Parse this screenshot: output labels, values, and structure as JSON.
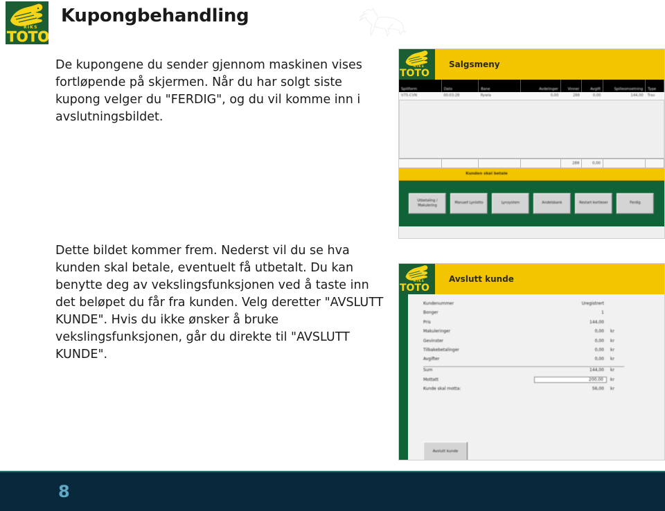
{
  "header": {
    "title": "Kupongbehandling",
    "logo": {
      "riks": "RIKS",
      "toto": "TOTO"
    }
  },
  "content": {
    "paragraph_1": "De kupongene du sender gjennom maskinen vises fortløpende på skjermen. Når du har solgt siste kupong velger du \"FERDIG\", og du vil komme inn i avslutningsbildet.",
    "paragraph_2": "Dette bildet kommer frem. Nederst vil du se hva kunden skal betale, eventuelt få utbetalt. Du kan benytte deg av vekslingsfunksjonen ved å taste inn det beløpet du får fra kunden. Velg deretter \"AVSLUTT KUNDE\". Hvis du ikke ønsker å bruke vekslingsfunksjonen, går du direkte til \"AVSLUTT KUNDE\"."
  },
  "screenshot_salgsmeny": {
    "title": "Salgsmeny",
    "logo": {
      "riks": "RIKS",
      "toto": "TOTO"
    },
    "table": {
      "columns": [
        "Spillform",
        "Dato",
        "Bane",
        "Avdelinger",
        "Vinner",
        "Avgift",
        "Spilleomsetning",
        "Type"
      ],
      "rows": [
        [
          "V75-CVN",
          "00:03:28",
          "Rywla",
          "0,00",
          "288",
          "0,00",
          "144,00",
          "Trav"
        ]
      ],
      "totals": [
        "",
        "",
        "",
        "",
        "288",
        "0,00",
        "",
        ""
      ]
    },
    "pay_bar_label": "Kunden skal betale",
    "buttons": [
      "Utbetaling / Makulering",
      "Manuell Lynlotto",
      "Lynsystem",
      "Andelsbank",
      "Restart kortleser",
      "Ferdig"
    ]
  },
  "screenshot_avslutt": {
    "title": "Avslutt kunde",
    "logo": {
      "riks": "RIKS",
      "toto": "TOTO"
    },
    "rows": [
      {
        "label": "Kundenummer",
        "value": "Uregistrert",
        "unit": ""
      },
      {
        "label": "Bonger",
        "value": "1",
        "unit": ""
      },
      {
        "label": "Pris",
        "value": "144,00",
        "unit": ""
      },
      {
        "label": "Makuleringer",
        "value": "0,00",
        "unit": "kr"
      },
      {
        "label": "Gevinster",
        "value": "0,00",
        "unit": "kr"
      },
      {
        "label": "Tilbakebetalinger",
        "value": "0,00",
        "unit": "kr"
      },
      {
        "label": "Avgifter",
        "value": "0,00",
        "unit": "kr"
      }
    ],
    "sum_row": {
      "label": "Sum",
      "value": "144,00",
      "unit": "kr"
    },
    "received_row": {
      "label": "Mottatt",
      "value": "200,00",
      "unit": "kr"
    },
    "change_row": {
      "label": "Kunde skal motta:",
      "value": "56,00",
      "unit": "kr"
    },
    "button_label": "Avslutt kunde"
  },
  "footer": {
    "page_number": "8"
  },
  "colors": {
    "brand_green": "#1b5e34",
    "brand_yellow": "#f3c400",
    "screen_green": "#0f6336",
    "footer_navy": "#08293b",
    "page_number": "#5fa9c4"
  }
}
